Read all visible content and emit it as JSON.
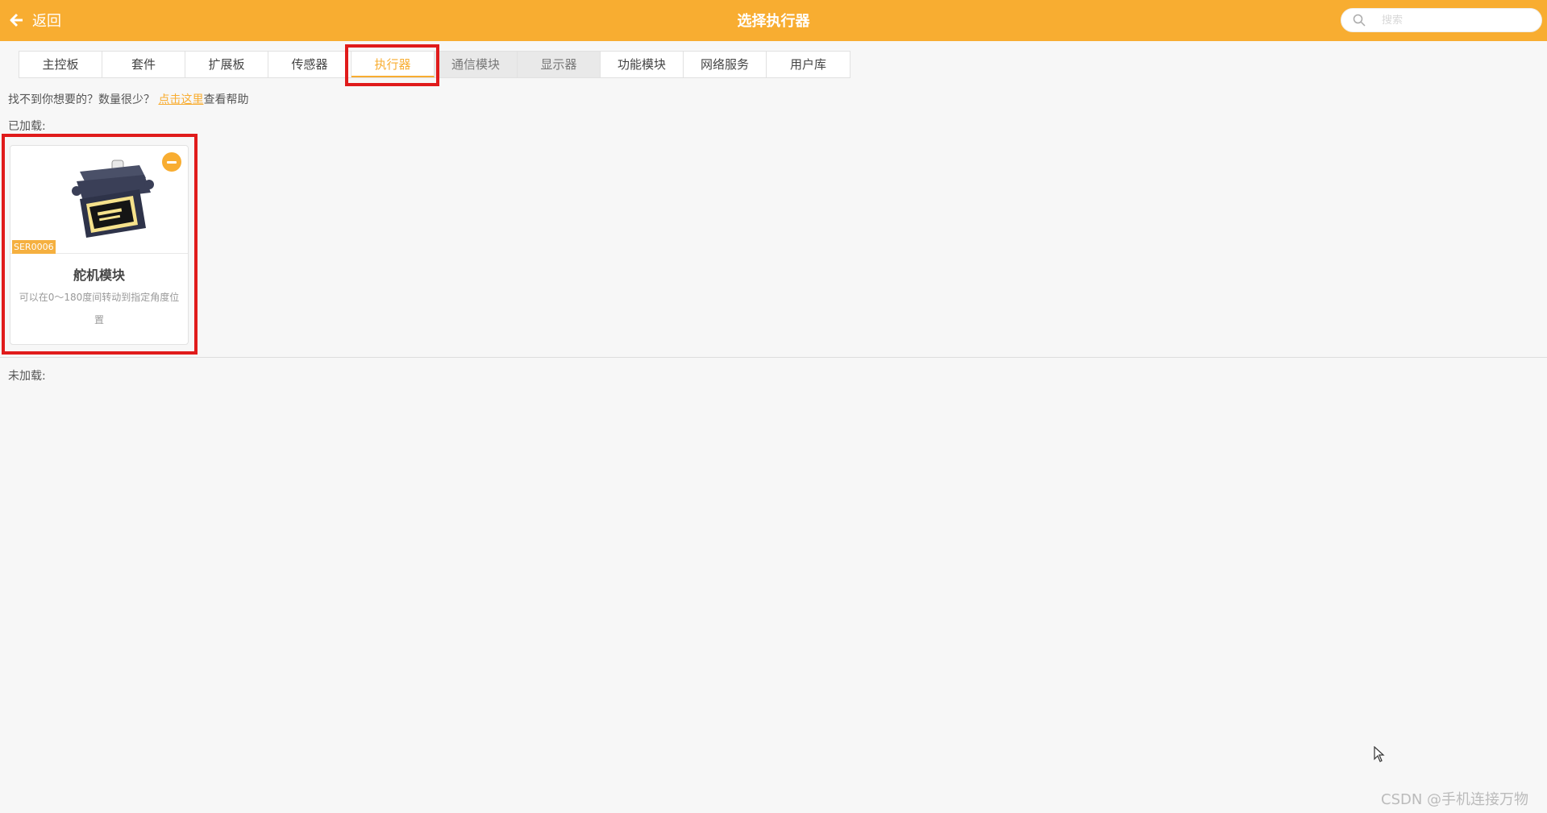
{
  "header": {
    "back_label": "返回",
    "title": "选择执行器",
    "search_placeholder": "搜索"
  },
  "tabs": [
    {
      "label": "主控板"
    },
    {
      "label": "套件"
    },
    {
      "label": "扩展板"
    },
    {
      "label": "传感器"
    },
    {
      "label": "执行器"
    },
    {
      "label": "通信模块"
    },
    {
      "label": "显示器"
    },
    {
      "label": "功能模块"
    },
    {
      "label": "网络服务"
    },
    {
      "label": "用户库"
    }
  ],
  "help": {
    "prefix": "找不到你想要的？数量很少？",
    "link": "点击这里",
    "suffix": "查看帮助"
  },
  "loaded_label": "已加载:",
  "unloaded_label": "未加载:",
  "loaded_items": [
    {
      "sku": "SER0006",
      "name": "舵机模块",
      "description": "可以在0～180度间转动到指定角度位置"
    }
  ],
  "watermark": "CSDN @手机连接万物",
  "colors": {
    "accent": "#f8ad31",
    "highlight": "#e01b1b"
  }
}
